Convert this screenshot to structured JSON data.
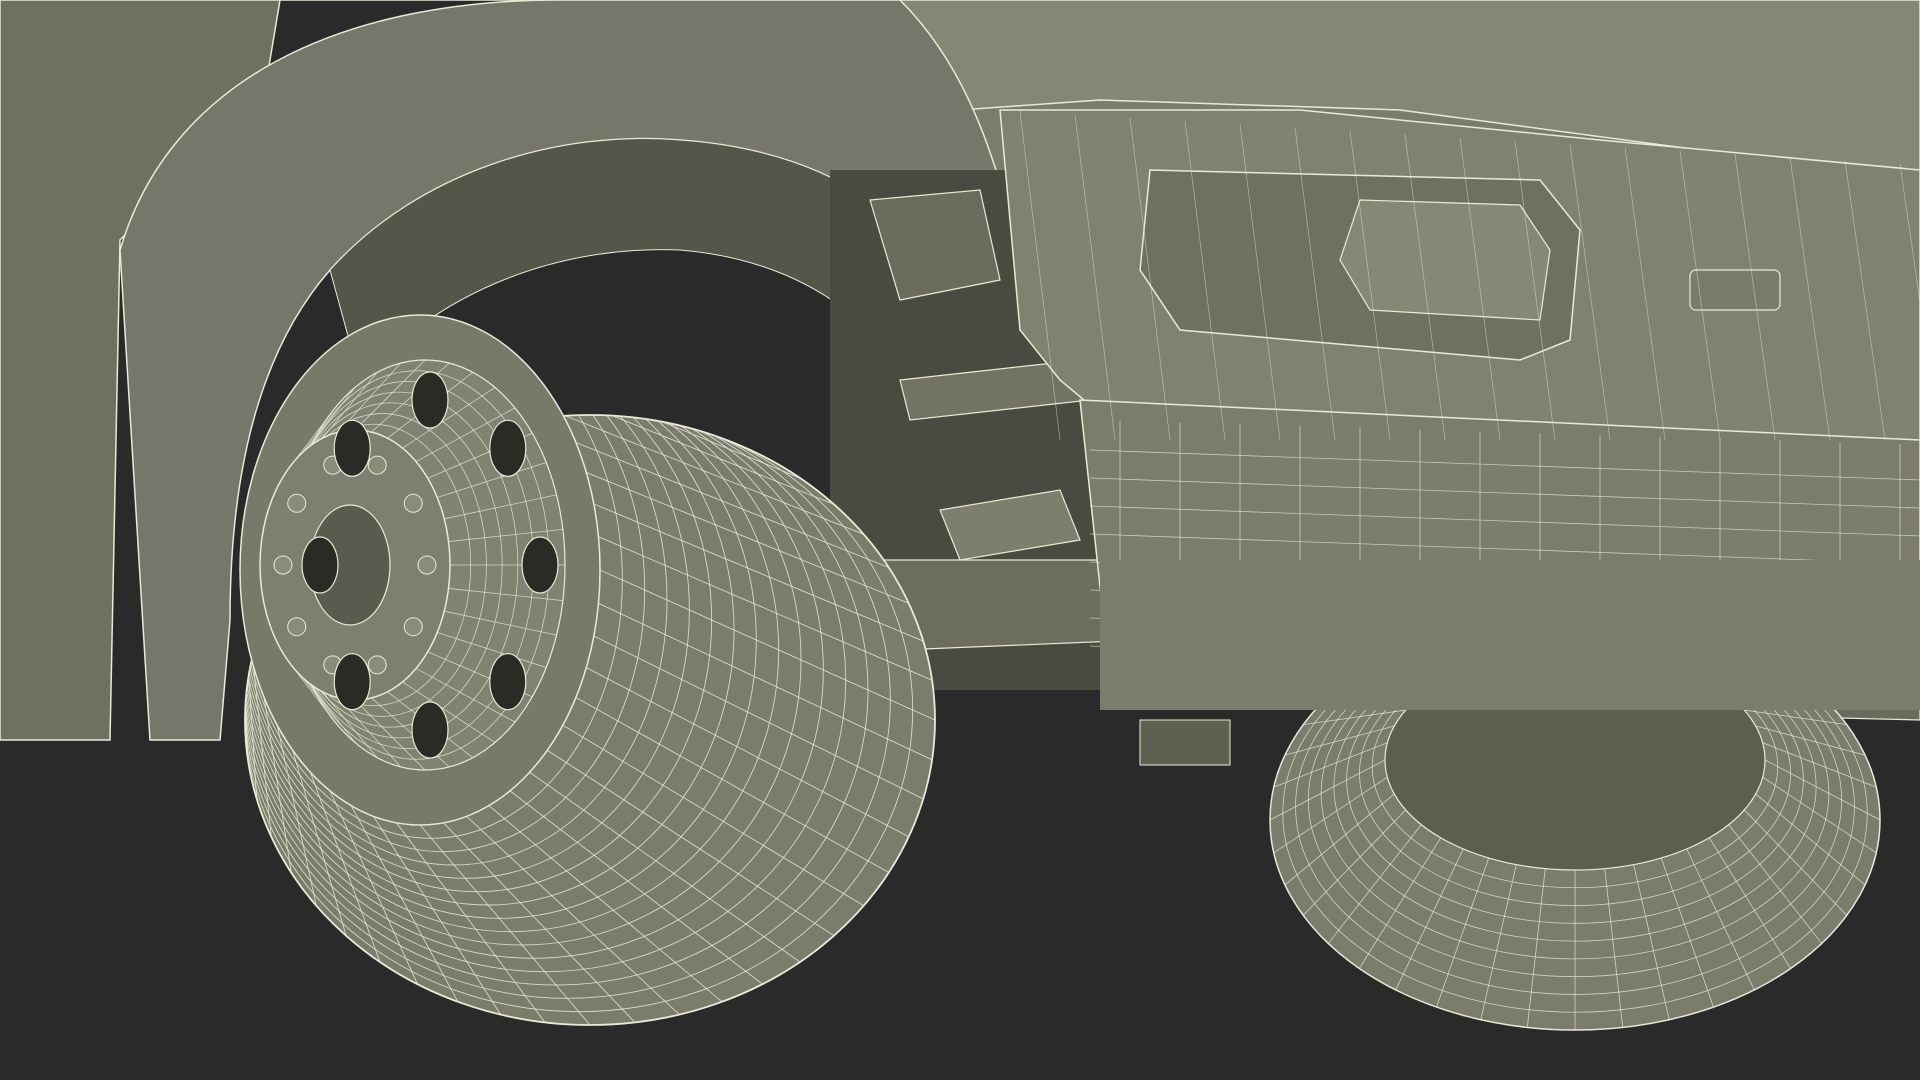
{
  "scene": {
    "subject": "wireframe-render-truck-front-wheel",
    "colors": {
      "background": "#2a2a2a",
      "surface": "#7b7c6b",
      "surface_light": "#8a8b79",
      "surface_dark": "#5f604f",
      "shadow": "#3f4036",
      "wire": "#e9ead5"
    },
    "icons": {
      "tire": "tire-shape",
      "rim": "rim-shape",
      "hub": "hub-shape",
      "bumper": "bumper-shape",
      "fender": "fender-shape",
      "suspension": "suspension-shape",
      "rear_wheel": "rear-wheel-shape"
    }
  }
}
